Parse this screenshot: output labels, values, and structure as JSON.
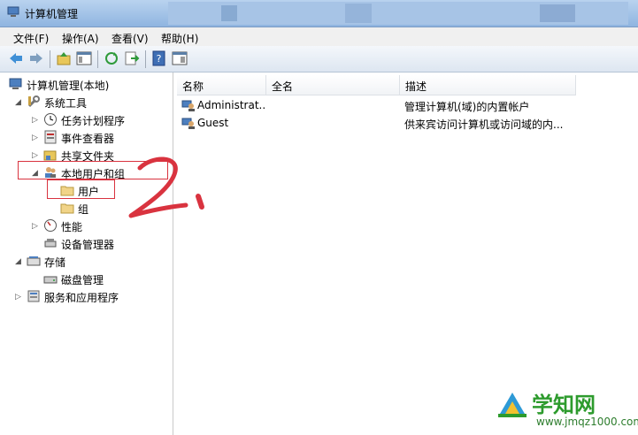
{
  "window": {
    "title": "计算机管理"
  },
  "menu": [
    "文件(F)",
    "操作(A)",
    "查看(V)",
    "帮助(H)"
  ],
  "toolbar": [
    "back-icon",
    "forward-icon",
    "up-icon",
    "show-hide-tree-icon",
    "refresh-icon",
    "export-icon",
    "help-icon",
    "properties-icon"
  ],
  "tree": {
    "root": "计算机管理(本地)",
    "system_tools": "系统工具",
    "task_scheduler": "任务计划程序",
    "event_viewer": "事件查看器",
    "shared_folders": "共享文件夹",
    "local_users_groups": "本地用户和组",
    "users": "用户",
    "groups": "组",
    "performance": "性能",
    "device_manager": "设备管理器",
    "storage": "存储",
    "disk_management": "磁盘管理",
    "services_apps": "服务和应用程序"
  },
  "list": {
    "columns": [
      "名称",
      "全名",
      "描述"
    ],
    "rows": [
      {
        "name": "Administrat...",
        "fullname": "",
        "desc": "管理计算机(域)的内置帐户"
      },
      {
        "name": "Guest",
        "fullname": "",
        "desc": "供来宾访问计算机或访问域的内..."
      }
    ]
  },
  "annotation": "2.",
  "watermark": {
    "brand": "学知网",
    "url": "www.jmqz1000.com"
  },
  "colors": {
    "highlight_box": "#d9333f",
    "watermark_green": "#2d9b2d"
  }
}
